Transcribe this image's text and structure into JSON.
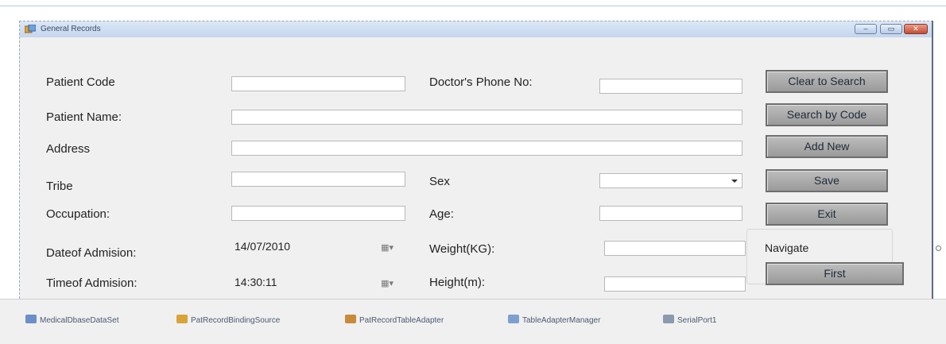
{
  "window": {
    "title": "General Records",
    "minimize_glyph": "–",
    "maximize_glyph": "▭",
    "close_glyph": "✕"
  },
  "fields": {
    "patient_code": {
      "label": "Patient Code",
      "value": ""
    },
    "doctor_phone": {
      "label": "Doctor's Phone No:",
      "value": ""
    },
    "patient_name": {
      "label": "Patient Name:",
      "value": ""
    },
    "address": {
      "label": "Address",
      "value": ""
    },
    "tribe": {
      "label": "Tribe",
      "value": ""
    },
    "sex": {
      "label": "Sex",
      "value": ""
    },
    "occupation": {
      "label": "Occupation:",
      "value": ""
    },
    "age": {
      "label": "Age:",
      "value": ""
    },
    "date_of_admission": {
      "label": "Dateof Admision:",
      "value": "14/07/2010"
    },
    "weight": {
      "label": "Weight(KG):",
      "value": ""
    },
    "time_of_admission": {
      "label": "Timeof Admision:",
      "value": "14:30:11"
    },
    "height": {
      "label": "Height(m):",
      "value": ""
    }
  },
  "buttons": {
    "clear_to_search": "Clear to Search",
    "search_by_code": "Search by Code",
    "add_new": "Add New",
    "save": "Save",
    "exit": "Exit",
    "first": "First"
  },
  "navigate_group_label": "Navigate",
  "component_tray": [
    {
      "label": "MedicalDbaseDataSet",
      "icon": "dataset-icon",
      "color": "#6a8fc9"
    },
    {
      "label": "PatRecordBindingSource",
      "icon": "binding-source-icon",
      "color": "#d9a23a"
    },
    {
      "label": "PatRecordTableAdapter",
      "icon": "table-adapter-icon",
      "color": "#c98a3a"
    },
    {
      "label": "TableAdapterManager",
      "icon": "adapter-manager-icon",
      "color": "#7d9fcf"
    },
    {
      "label": "SerialPort1",
      "icon": "serial-port-icon",
      "color": "#8a9bb0"
    }
  ]
}
